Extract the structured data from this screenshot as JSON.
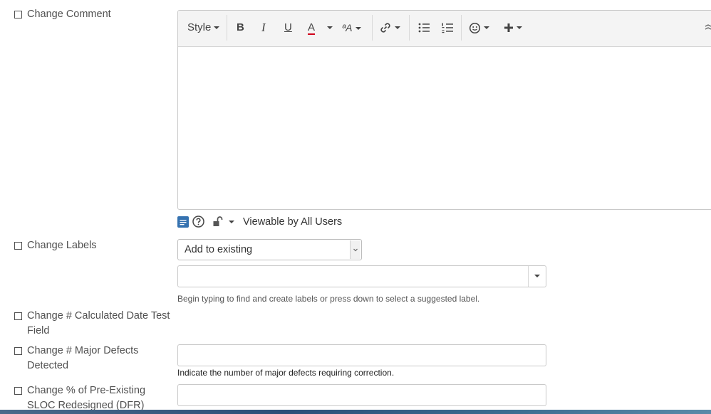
{
  "comment": {
    "label": "Change Comment",
    "toolbar": {
      "style_label": "Style",
      "bold": "B",
      "italic": "I",
      "underline": "U",
      "text_color": "A",
      "text_color_hex": "#d0021b",
      "font_size": "ªA"
    },
    "restrictions": {
      "viewable_label": "Viewable by All Users"
    }
  },
  "labels": {
    "label": "Change Labels",
    "mode_value": "Add to existing",
    "help": "Begin typing to find and create labels or press down to select a suggested label."
  },
  "calculated_date": {
    "label_line1": "Change # Calculated Date Test",
    "label_line2": "Field"
  },
  "major_defects": {
    "label_line1": "Change # Major Defects",
    "label_line2": "Detected",
    "help": "Indicate the number of major defects requiring correction."
  },
  "pre_existing": {
    "label_line1": "Change % of Pre-Existing",
    "label_line2": "SLOC Redesigned (DFR)"
  }
}
